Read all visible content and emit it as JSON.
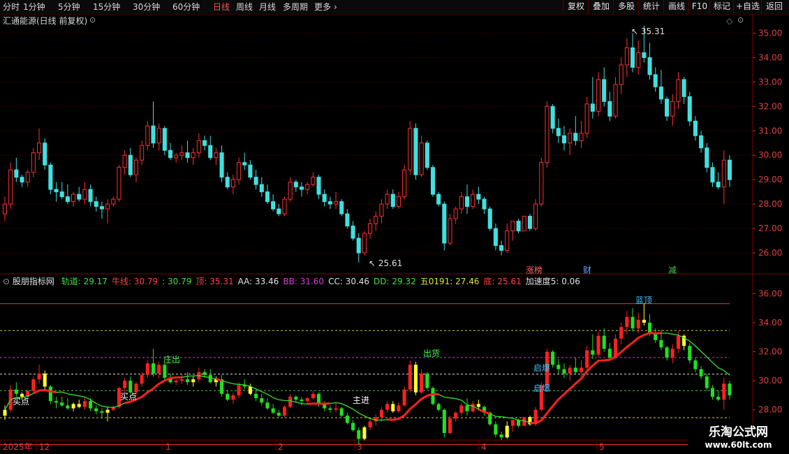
{
  "toolbar": {
    "timeframes": [
      "分时",
      "1分钟",
      "5分钟",
      "15分钟",
      "30分钟",
      "60分钟",
      "日线",
      "周线",
      "月线",
      "多周期",
      "更多"
    ],
    "active": "日线",
    "buttons": [
      "复权",
      "叠加",
      "多股",
      "统计",
      "画线",
      "F10",
      "标记",
      "+自选",
      "返回"
    ]
  },
  "stock": {
    "title": "汇通能源(日线 前复权)"
  },
  "main_chart": {
    "y_ticks": [
      "35.00",
      "34.00",
      "33.00",
      "32.00",
      "31.00",
      "30.00",
      "29.00",
      "28.00",
      "27.00",
      "26.00"
    ],
    "high_label": "35.31",
    "low_label": "25.61",
    "events": [
      {
        "text": "涨榜",
        "color": "#ff6060"
      },
      {
        "text": "财",
        "color": "#60a0ff"
      },
      {
        "text": "减",
        "color": "#40d040"
      }
    ]
  },
  "indicator": {
    "name": "股朋指标网",
    "values": [
      {
        "label": "轨道: 29.17",
        "color": "#40e040"
      },
      {
        "label": "牛线: 30.79",
        "color": "#ff4040"
      },
      {
        "label": ": 30.79",
        "color": "#40e040"
      },
      {
        "label": "顶: 35.31",
        "color": "#ff4040"
      },
      {
        "label": "AA: 33.46",
        "color": "#e0e0e0"
      },
      {
        "label": "BB: 31.60",
        "color": "#d040d0"
      },
      {
        "label": "CC: 30.46",
        "color": "#e0e0e0"
      },
      {
        "label": "DD: 29.32",
        "color": "#40e040"
      },
      {
        "label": "五0191: 27.46",
        "color": "#e0e040"
      },
      {
        "label": "底: 25.61",
        "color": "#ff4040"
      },
      {
        "label": "加速度5: 0.06",
        "color": "#e0e0e0"
      }
    ],
    "y_ticks": [
      "36.00",
      "34.00",
      "32.00",
      "30.00",
      "28.00"
    ],
    "signals": [
      {
        "text": "买点",
        "color": "#ffffff"
      },
      {
        "text": "买点",
        "color": "#ffffff"
      },
      {
        "text": "庄出",
        "color": "#40ff40"
      },
      {
        "text": "出货",
        "color": "#40ff40"
      },
      {
        "text": "启爆",
        "color": "#40c0ff"
      },
      {
        "text": "启爆",
        "color": "#40c0ff"
      },
      {
        "text": "蓝顶",
        "color": "#40c0ff"
      },
      {
        "text": "主进",
        "color": "#ffffff"
      }
    ]
  },
  "time_axis": [
    "2025年",
    "12",
    "1",
    "2",
    "3",
    "4",
    "5"
  ],
  "watermark": {
    "line1": "乐淘公式网",
    "line2": "www.60lt.com"
  },
  "colors": {
    "up": "#ff3030",
    "down": "#40e0e0",
    "grid": "#6a0000",
    "bull": "#ff2020"
  },
  "chart_data": {
    "type": "candlestick",
    "series": [
      {
        "name": "汇通能源",
        "values": [
          [
            27.6,
            28.3,
            27.3,
            28.0
          ],
          [
            28.0,
            29.7,
            27.8,
            29.4
          ],
          [
            29.4,
            29.9,
            28.9,
            29.1
          ],
          [
            29.1,
            29.2,
            28.7,
            28.9
          ],
          [
            28.9,
            29.4,
            28.7,
            29.3
          ],
          [
            29.3,
            30.3,
            29.1,
            30.1
          ],
          [
            30.1,
            31.1,
            29.8,
            30.5
          ],
          [
            30.5,
            30.7,
            29.4,
            29.6
          ],
          [
            29.6,
            29.7,
            28.4,
            28.6
          ],
          [
            28.6,
            28.9,
            28.1,
            28.5
          ],
          [
            28.5,
            28.9,
            28.2,
            28.3
          ],
          [
            28.3,
            28.8,
            28.0,
            28.1
          ],
          [
            28.1,
            28.5,
            27.9,
            28.4
          ],
          [
            28.4,
            28.7,
            28.1,
            28.2
          ],
          [
            28.2,
            28.9,
            28.0,
            28.6
          ],
          [
            28.6,
            28.8,
            27.9,
            28.1
          ],
          [
            28.1,
            28.3,
            27.7,
            27.9
          ],
          [
            27.9,
            28.1,
            27.4,
            27.8
          ],
          [
            27.8,
            28.2,
            27.2,
            28.0
          ],
          [
            28.0,
            28.3,
            27.9,
            28.2
          ],
          [
            28.2,
            29.6,
            28.1,
            29.5
          ],
          [
            29.5,
            30.2,
            29.2,
            30.0
          ],
          [
            30.0,
            30.3,
            29.1,
            29.2
          ],
          [
            29.2,
            29.9,
            28.9,
            29.8
          ],
          [
            29.8,
            30.6,
            29.6,
            30.4
          ],
          [
            30.4,
            31.4,
            30.2,
            31.2
          ],
          [
            31.2,
            32.2,
            30.3,
            30.5
          ],
          [
            30.5,
            31.3,
            30.2,
            31.1
          ],
          [
            31.1,
            31.2,
            30.0,
            30.2
          ],
          [
            30.2,
            30.5,
            29.8,
            29.9
          ],
          [
            29.9,
            30.1,
            29.7,
            30.0
          ],
          [
            30.0,
            30.4,
            29.8,
            30.1
          ],
          [
            30.1,
            30.6,
            29.7,
            29.9
          ],
          [
            29.9,
            30.3,
            29.6,
            30.1
          ],
          [
            30.1,
            30.9,
            29.9,
            30.6
          ],
          [
            30.6,
            30.8,
            30.2,
            30.4
          ],
          [
            30.4,
            30.8,
            29.8,
            29.9
          ],
          [
            29.9,
            30.3,
            29.6,
            30.1
          ],
          [
            30.1,
            30.4,
            28.9,
            29.1
          ],
          [
            29.1,
            29.3,
            28.6,
            28.7
          ],
          [
            28.7,
            29.2,
            28.4,
            29.0
          ],
          [
            29.0,
            29.9,
            28.8,
            29.7
          ],
          [
            29.7,
            30.1,
            29.4,
            29.6
          ],
          [
            29.6,
            29.8,
            29.0,
            29.1
          ],
          [
            29.1,
            29.4,
            28.6,
            28.8
          ],
          [
            28.8,
            29.1,
            28.3,
            28.5
          ],
          [
            28.5,
            28.8,
            28.0,
            28.1
          ],
          [
            28.1,
            28.4,
            27.7,
            27.8
          ],
          [
            27.8,
            28.0,
            27.5,
            27.6
          ],
          [
            27.6,
            28.3,
            27.5,
            28.2
          ],
          [
            28.2,
            29.1,
            28.1,
            28.9
          ],
          [
            28.9,
            29.0,
            28.5,
            28.7
          ],
          [
            28.7,
            28.9,
            28.3,
            28.6
          ],
          [
            28.6,
            28.9,
            28.4,
            28.8
          ],
          [
            28.8,
            29.3,
            28.7,
            29.1
          ],
          [
            29.1,
            29.2,
            28.2,
            28.4
          ],
          [
            28.4,
            28.6,
            27.9,
            28.1
          ],
          [
            28.1,
            28.3,
            27.8,
            28.0
          ],
          [
            28.0,
            28.5,
            27.8,
            28.1
          ],
          [
            28.1,
            28.2,
            27.5,
            27.6
          ],
          [
            27.6,
            27.8,
            27.0,
            27.1
          ],
          [
            27.1,
            27.3,
            26.5,
            26.6
          ],
          [
            26.6,
            26.8,
            25.61,
            26.0
          ],
          [
            26.0,
            26.9,
            25.9,
            26.8
          ],
          [
            26.8,
            27.4,
            26.6,
            27.2
          ],
          [
            27.2,
            27.7,
            26.9,
            27.5
          ],
          [
            27.5,
            28.2,
            27.2,
            28.0
          ],
          [
            28.0,
            28.6,
            27.8,
            28.4
          ],
          [
            28.4,
            28.6,
            27.8,
            27.9
          ],
          [
            27.9,
            28.5,
            27.8,
            28.3
          ],
          [
            28.3,
            29.6,
            28.2,
            29.4
          ],
          [
            29.4,
            31.4,
            29.2,
            31.1
          ],
          [
            31.1,
            31.3,
            29.0,
            29.2
          ],
          [
            29.2,
            30.8,
            29.1,
            30.5
          ],
          [
            30.5,
            30.6,
            29.4,
            29.5
          ],
          [
            29.5,
            29.6,
            28.3,
            28.4
          ],
          [
            28.4,
            28.5,
            27.9,
            28.0
          ],
          [
            28.0,
            28.1,
            26.1,
            26.4
          ],
          [
            26.4,
            27.6,
            26.3,
            27.4
          ],
          [
            27.4,
            27.9,
            27.2,
            27.8
          ],
          [
            27.8,
            28.5,
            27.6,
            28.3
          ],
          [
            28.3,
            28.8,
            27.6,
            27.9
          ],
          [
            27.9,
            28.6,
            27.8,
            28.4
          ],
          [
            28.4,
            28.7,
            28.0,
            28.2
          ],
          [
            28.2,
            28.3,
            27.6,
            27.8
          ],
          [
            27.8,
            27.9,
            26.9,
            27.0
          ],
          [
            27.0,
            27.2,
            26.1,
            26.3
          ],
          [
            26.3,
            26.5,
            25.9,
            26.1
          ],
          [
            26.1,
            27.2,
            26.0,
            26.9
          ],
          [
            26.9,
            27.3,
            26.5,
            27.3
          ],
          [
            27.3,
            27.4,
            26.8,
            26.9
          ],
          [
            26.9,
            27.5,
            26.9,
            27.5
          ],
          [
            27.5,
            27.6,
            26.9,
            27.0
          ],
          [
            27.0,
            28.2,
            26.9,
            28.0
          ],
          [
            28.0,
            29.9,
            27.9,
            29.7
          ],
          [
            29.7,
            32.2,
            29.5,
            32.0
          ],
          [
            32.0,
            32.1,
            30.9,
            31.1
          ],
          [
            31.1,
            31.5,
            30.5,
            30.8
          ],
          [
            30.8,
            31.2,
            30.2,
            30.5
          ],
          [
            30.5,
            31.1,
            30.0,
            30.9
          ],
          [
            30.9,
            31.6,
            30.4,
            30.6
          ],
          [
            30.6,
            31.4,
            30.3,
            30.9
          ],
          [
            30.9,
            32.4,
            30.7,
            32.1
          ],
          [
            32.1,
            33.2,
            31.5,
            31.8
          ],
          [
            31.8,
            33.4,
            31.6,
            33.1
          ],
          [
            33.1,
            33.6,
            32.0,
            32.2
          ],
          [
            32.2,
            32.6,
            31.4,
            31.6
          ],
          [
            31.6,
            33.2,
            31.5,
            32.9
          ],
          [
            32.9,
            34.0,
            32.5,
            33.7
          ],
          [
            33.7,
            34.8,
            33.2,
            34.4
          ],
          [
            34.4,
            35.0,
            33.4,
            33.6
          ],
          [
            33.6,
            34.7,
            33.3,
            34.2
          ],
          [
            34.2,
            35.31,
            33.8,
            34.0
          ],
          [
            34.0,
            34.6,
            33.1,
            33.3
          ],
          [
            33.3,
            33.6,
            32.6,
            32.8
          ],
          [
            32.8,
            33.5,
            32.1,
            32.3
          ],
          [
            32.3,
            32.4,
            31.4,
            31.6
          ],
          [
            31.6,
            32.5,
            31.2,
            32.2
          ],
          [
            32.2,
            33.4,
            31.9,
            33.1
          ],
          [
            33.1,
            33.2,
            32.1,
            32.4
          ],
          [
            32.4,
            32.6,
            31.2,
            31.4
          ],
          [
            31.4,
            31.6,
            30.6,
            30.8
          ],
          [
            30.8,
            31.0,
            30.1,
            30.3
          ],
          [
            30.3,
            30.5,
            29.3,
            29.5
          ],
          [
            29.5,
            29.7,
            28.7,
            28.9
          ],
          [
            28.9,
            29.3,
            28.6,
            28.7
          ],
          [
            28.7,
            30.2,
            28.0,
            29.8
          ],
          [
            29.8,
            30.0,
            28.7,
            29.0
          ]
        ]
      }
    ]
  }
}
